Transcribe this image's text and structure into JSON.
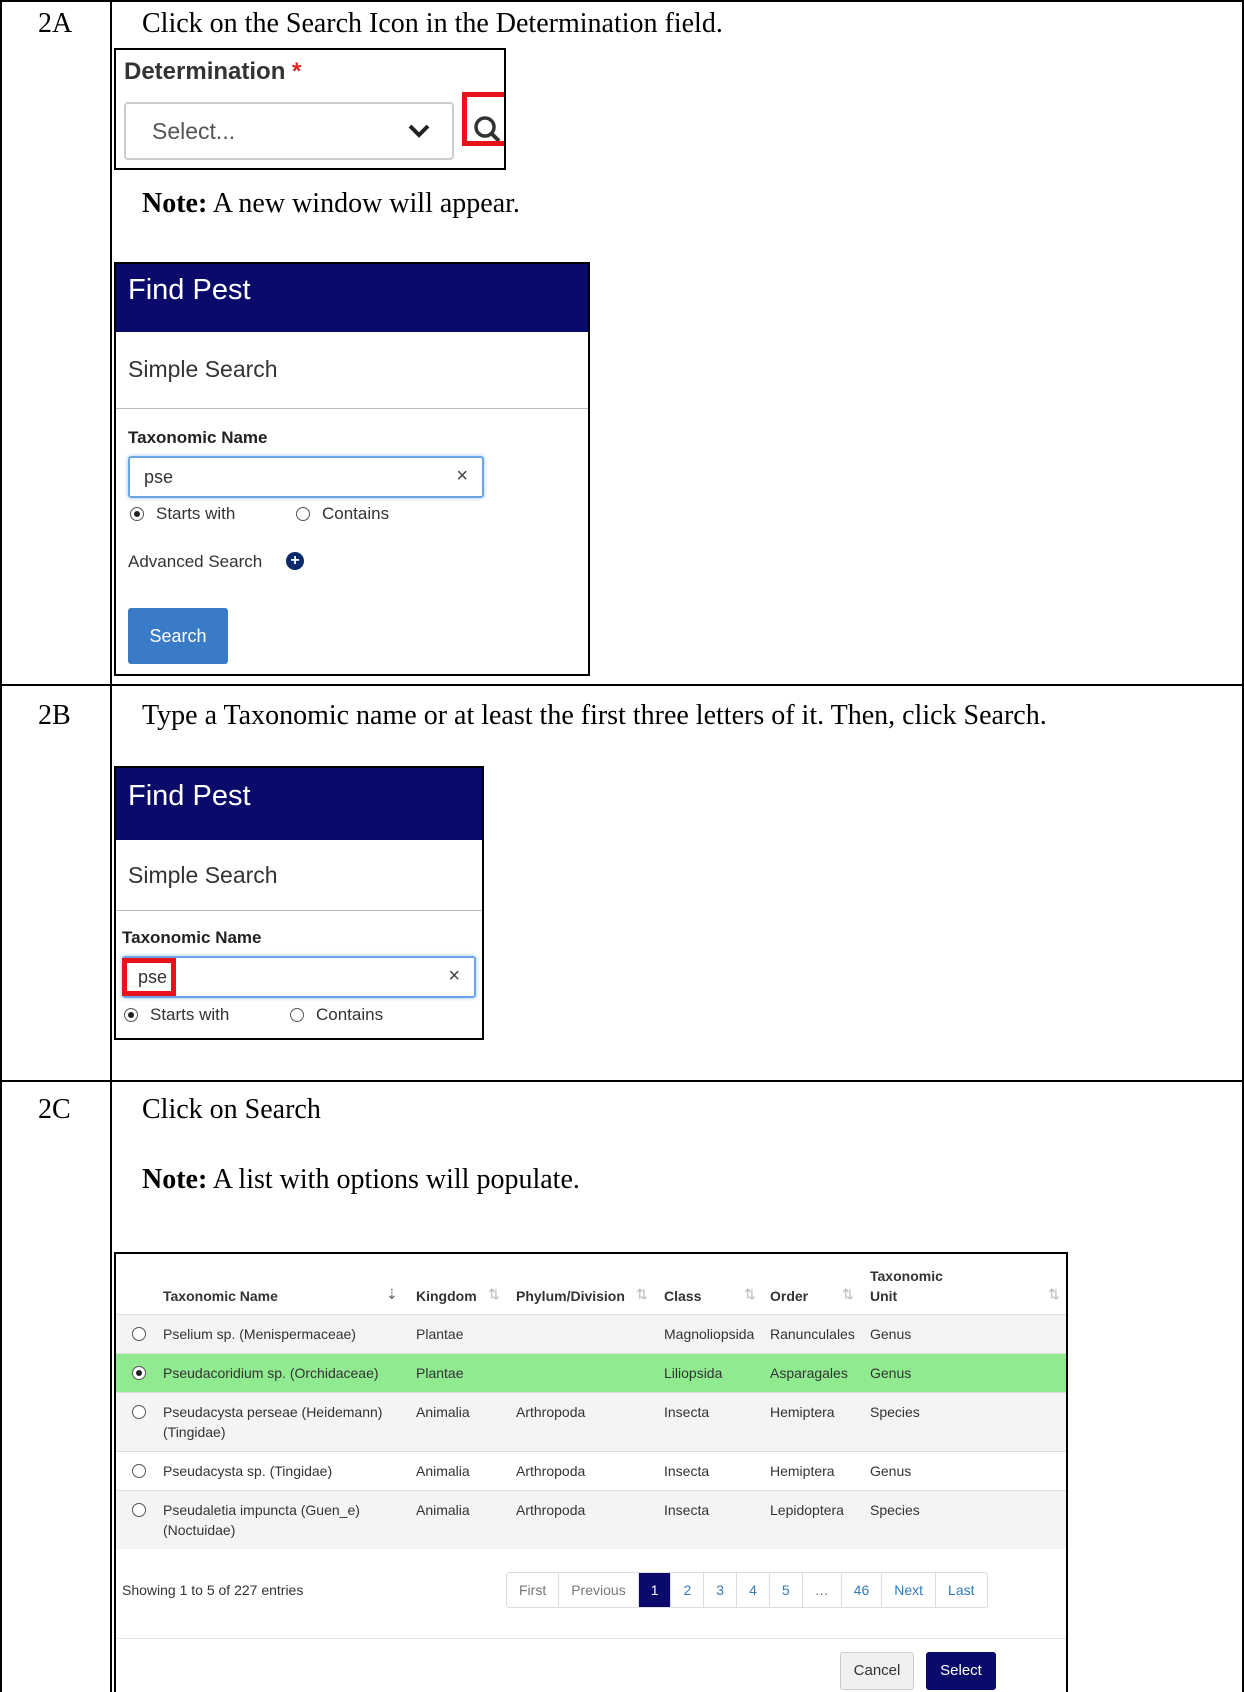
{
  "steps": [
    {
      "id": "2A",
      "instruction": "Click on the Search Icon in the Determination field.",
      "note_label": "Note:",
      "note_text": " A new window will appear."
    },
    {
      "id": "2B",
      "instruction": "Type a Taxonomic name or at least the first three letters of it. Then, click Search."
    },
    {
      "id": "2C",
      "instruction": "Click on Search",
      "note_label": "Note:",
      "note_text": " A list with options will populate."
    }
  ],
  "determination": {
    "label": "Determination",
    "required_mark": "*",
    "select_placeholder": "Select..."
  },
  "find_pest": {
    "title": "Find Pest",
    "subtitle": "Simple Search",
    "field_label": "Taxonomic Name",
    "input_value": "pse",
    "clear_glyph": "×",
    "radio_starts": "Starts with",
    "radio_contains": "Contains",
    "advanced": "Advanced Search",
    "search_button": "Search"
  },
  "results": {
    "headers": [
      "Taxonomic Name",
      "Kingdom",
      "Phylum/Division",
      "Class",
      "Order",
      "Taxonomic",
      "Unit"
    ],
    "rows": [
      {
        "name": [
          "Pselium sp. (Menispermaceae)"
        ],
        "kingdom": "Plantae",
        "phylum": "",
        "class": "Magnoliopsida",
        "order": "Ranunculales",
        "unit": "Genus",
        "selected": false
      },
      {
        "name": [
          "Pseudacoridium sp. (Orchidaceae)"
        ],
        "kingdom": "Plantae",
        "phylum": "",
        "class": "Liliopsida",
        "order": "Asparagales",
        "unit": "Genus",
        "selected": true
      },
      {
        "name": [
          "Pseudacysta perseae (Heidemann)",
          "(Tingidae)"
        ],
        "kingdom": "Animalia",
        "phylum": "Arthropoda",
        "class": "Insecta",
        "order": "Hemiptera",
        "unit": "Species",
        "selected": false
      },
      {
        "name": [
          "Pseudacysta sp. (Tingidae)"
        ],
        "kingdom": "Animalia",
        "phylum": "Arthropoda",
        "class": "Insecta",
        "order": "Hemiptera",
        "unit": "Genus",
        "selected": false
      },
      {
        "name": [
          "Pseudaletia impuncta (Guen_e)",
          "(Noctuidae)"
        ],
        "kingdom": "Animalia",
        "phylum": "Arthropoda",
        "class": "Insecta",
        "order": "Lepidoptera",
        "unit": "Species",
        "selected": false
      }
    ],
    "showing": "Showing 1 to 5 of 227 entries",
    "pager": [
      "First",
      "Previous",
      "1",
      "2",
      "3",
      "4",
      "5",
      "…",
      "46",
      "Next",
      "Last"
    ],
    "current_page": "1",
    "cancel": "Cancel",
    "select": "Select"
  }
}
